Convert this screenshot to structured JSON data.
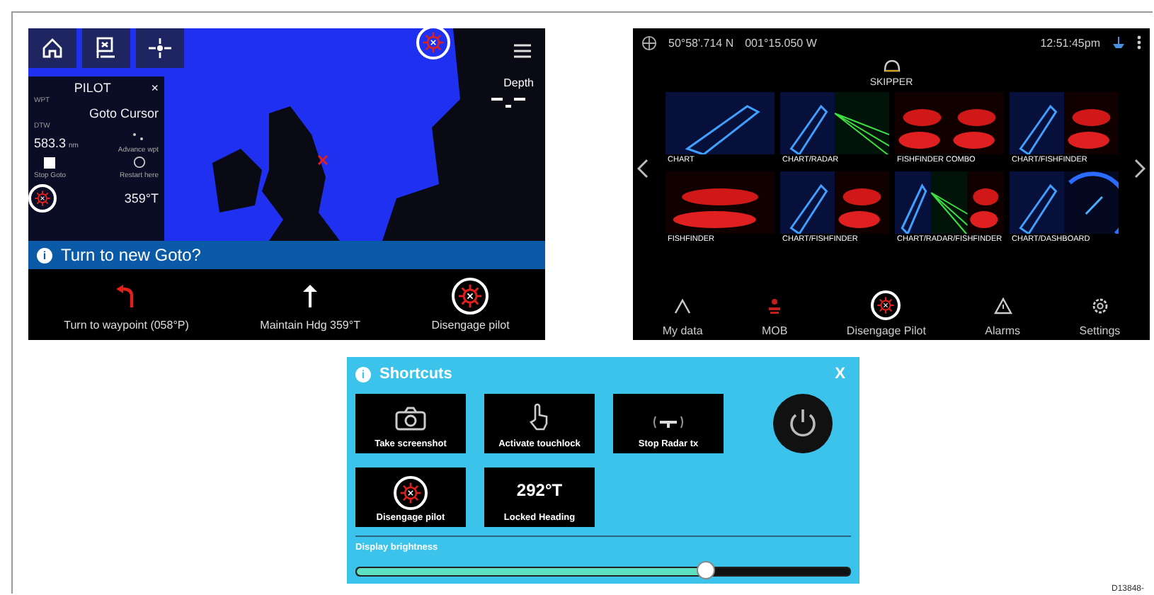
{
  "chart_screen": {
    "toolbar": [
      {
        "kind": "home"
      },
      {
        "kind": "route"
      },
      {
        "kind": "waypoint"
      }
    ],
    "autopilot_icon": {
      "highlighted": true
    },
    "depth_label": "Depth",
    "pilot_panel": {
      "title": "PILOT",
      "close": "×",
      "wpt_label": "WPT",
      "wpt_value": "Goto Cursor",
      "dtw_label": "DTW",
      "dtw_value": "583.3",
      "dtw_unit": "nm",
      "advance": "Advance wpt",
      "stop": "Stop Goto",
      "restart": "Restart here",
      "heading": "359°T",
      "pilot_highlighted": true
    },
    "banner": {
      "info": "i",
      "text": "Turn to new Goto?"
    },
    "actions": [
      {
        "kind": "turn",
        "label": "Turn to waypoint (058°P)",
        "highlighted": false
      },
      {
        "kind": "maintain",
        "label": "Maintain Hdg 359°T",
        "highlighted": false
      },
      {
        "kind": "pilot",
        "label": "Disengage pilot",
        "highlighted": true
      }
    ]
  },
  "home_screen": {
    "latitude": "50°58'.714 N",
    "longitude": "001°15.050 W",
    "time": "12:51:45pm",
    "profile": "SKIPPER",
    "tiles": [
      {
        "label": "CHART",
        "panes": [
          {
            "kind": "chart"
          }
        ]
      },
      {
        "label": "CHART/RADAR",
        "panes": [
          {
            "kind": "chart"
          },
          {
            "kind": "radar"
          }
        ]
      },
      {
        "label": "FISHFINDER COMBO",
        "panes": [
          {
            "kind": "fish"
          },
          {
            "kind": "fish"
          }
        ]
      },
      {
        "label": "CHART/FISHFINDER",
        "panes": [
          {
            "kind": "chart"
          },
          {
            "kind": "fish"
          }
        ]
      },
      {
        "label": "FISHFINDER",
        "panes": [
          {
            "kind": "fish"
          }
        ]
      },
      {
        "label": "CHART/FISHFINDER",
        "panes": [
          {
            "kind": "chart"
          },
          {
            "kind": "fish"
          }
        ]
      },
      {
        "label": "CHART/RADAR/FISHFINDER",
        "panes": [
          {
            "kind": "chart"
          },
          {
            "kind": "radar"
          },
          {
            "kind": "fish"
          }
        ]
      },
      {
        "label": "CHART/DASHBOARD",
        "panes": [
          {
            "kind": "chart"
          },
          {
            "kind": "dash"
          }
        ]
      }
    ],
    "nav": [
      {
        "kind": "data",
        "label": "My data",
        "highlighted": false
      },
      {
        "kind": "mob",
        "label": "MOB",
        "highlighted": false
      },
      {
        "kind": "pilot",
        "label": "Disengage Pilot",
        "highlighted": true
      },
      {
        "kind": "alarm",
        "label": "Alarms",
        "highlighted": false
      },
      {
        "kind": "settings",
        "label": "Settings",
        "highlighted": false
      }
    ]
  },
  "shortcuts": {
    "info": "i",
    "title": "Shortcuts",
    "close": "X",
    "buttons": [
      {
        "kind": "camera",
        "label": "Take screenshot",
        "highlighted": false
      },
      {
        "kind": "touch",
        "label": "Activate touchlock",
        "highlighted": false
      },
      {
        "kind": "radar",
        "label": "Stop Radar tx",
        "highlighted": false
      },
      {
        "kind": "pilot",
        "label": "Disengage pilot",
        "highlighted": true
      },
      {
        "kind": "heading",
        "value": "292°T",
        "label": "Locked Heading",
        "highlighted": false
      }
    ],
    "brightness": {
      "label": "Display brightness",
      "level": 0.71
    }
  },
  "figure_id": "D13848-"
}
